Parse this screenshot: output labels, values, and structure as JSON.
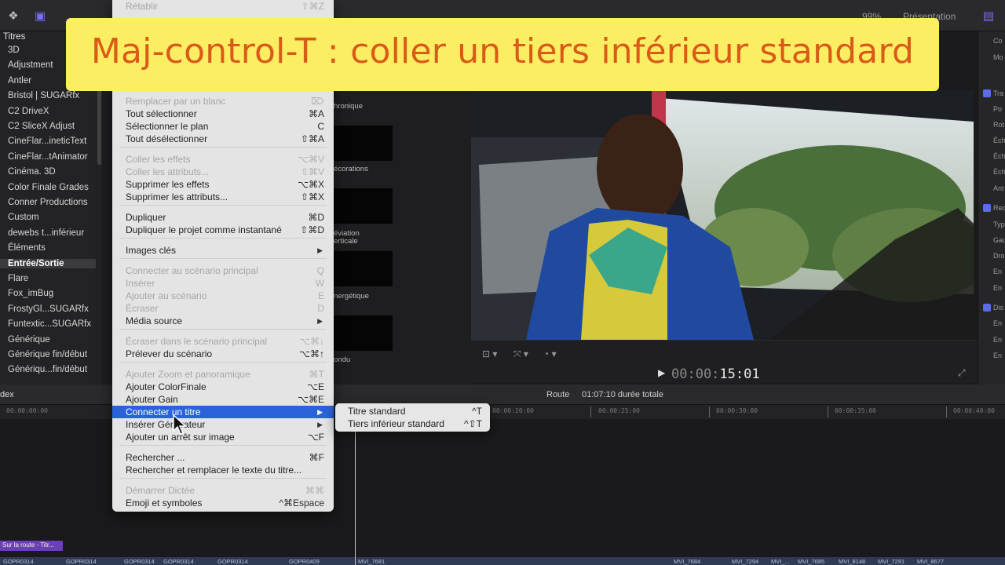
{
  "banner": {
    "text": "Maj-control-T : coller un tiers inférieur standard"
  },
  "topbar": {
    "right_label": "Présentation",
    "right_pct": "99%"
  },
  "sidebar": {
    "header": "Titres",
    "items": [
      "3D",
      "Adjustment",
      "Antler",
      "Bristol | SUGARfx",
      "C2 DriveX",
      "C2 SliceX Adjust",
      "CineFlar...ineticText",
      "CineFlar...tAnimator",
      "Cinéma. 3D",
      "Color Finale Grades",
      "Conner Productions",
      "Custom",
      "dewebs t...inférieur",
      "Éléments",
      "Entrée/Sortie",
      "Flare",
      "Fox_imBug",
      "FrostyGl...SUGARfx",
      "Funtextic...SUGARfx",
      "Générique",
      "Générique fin/début",
      "Génériqu...fin/début"
    ],
    "selected_index": 14
  },
  "browser_labels": [
    "hronique",
    "écorations",
    "éviation",
    "erticale",
    "nergétique",
    "ondu"
  ],
  "menu": {
    "items": [
      {
        "label": "Rétablir",
        "shortcut": "⇧⌘Z",
        "disabled": true
      },
      {
        "label": "Remplacer par un blanc",
        "shortcut": "⌦",
        "disabled": true
      },
      {
        "label": "Tout sélectionner",
        "shortcut": "⌘A"
      },
      {
        "label": "Sélectionner le plan",
        "shortcut": "C"
      },
      {
        "label": "Tout désélectionner",
        "shortcut": "⇧⌘A"
      },
      {
        "label": "Coller les effets",
        "shortcut": "⌥⌘V",
        "disabled": true
      },
      {
        "label": "Coller les attributs...",
        "shortcut": "⇧⌘V",
        "disabled": true
      },
      {
        "label": "Supprimer les effets",
        "shortcut": "⌥⌘X"
      },
      {
        "label": "Supprimer les attributs...",
        "shortcut": "⇧⌘X"
      },
      {
        "label": "Dupliquer",
        "shortcut": "⌘D"
      },
      {
        "label": "Dupliquer le projet comme instantané",
        "shortcut": "⇧⌘D"
      },
      {
        "label": "Images clés",
        "submenu": true
      },
      {
        "label": "Connecter au scénario principal",
        "shortcut": "Q",
        "disabled": true
      },
      {
        "label": "Insérer",
        "shortcut": "W",
        "disabled": true
      },
      {
        "label": "Ajouter au scénario",
        "shortcut": "E",
        "disabled": true
      },
      {
        "label": "Écraser",
        "shortcut": "D",
        "disabled": true
      },
      {
        "label": "Média source",
        "submenu": true
      },
      {
        "label": "Écraser dans le scénario principal",
        "shortcut": "⌥⌘↓",
        "disabled": true
      },
      {
        "label": "Prélever du scénario",
        "shortcut": "⌥⌘↑"
      },
      {
        "label": "Ajouter Zoom et panoramique",
        "shortcut": "⌘T",
        "disabled": true
      },
      {
        "label": "Ajouter ColorFinale",
        "shortcut": "⌥E"
      },
      {
        "label": "Ajouter Gain",
        "shortcut": "⌥⌘E"
      },
      {
        "label": "Connecter un titre",
        "submenu": true,
        "highlighted": true
      },
      {
        "label": "Insérer Générateur",
        "submenu": true
      },
      {
        "label": "Ajouter un arrêt sur image",
        "shortcut": "⌥F"
      },
      {
        "label": "Rechercher ...",
        "shortcut": "⌘F"
      },
      {
        "label": "Rechercher et remplacer le texte du titre..."
      },
      {
        "label": "Démarrer Dictée",
        "shortcut": "⌘⌘",
        "disabled": true
      },
      {
        "label": "Emoji et symboles",
        "shortcut": "^⌘Espace"
      }
    ]
  },
  "submenu": {
    "items": [
      {
        "label": "Titre standard",
        "shortcut": "^T"
      },
      {
        "label": "Tiers inférieur standard",
        "shortcut": "^⇧T"
      }
    ]
  },
  "viewer": {
    "timecode_dim": "00:00:",
    "timecode": "15:01"
  },
  "timeline": {
    "index_label": "dex",
    "project_name": "Route",
    "duration": "01:07:10 durée totale",
    "ticks": [
      "00:00:00:00",
      "00:00:20:00",
      "00:00:25:00",
      "00:00:30:00",
      "00:00:35:00",
      "00:00:40:00"
    ],
    "title_clip": "Sur la route - Titr...",
    "clips": [
      "GOPR0314",
      "GOPR0314",
      "GOPR0314",
      "GOPR0314",
      "GOPR0314",
      "GOPR0409",
      "MVI_7681",
      "MVI_7684",
      "MVI_7294",
      "MVI_...",
      "MVI_7685",
      "MVI_8148",
      "MVI_7291",
      "MVI_8677"
    ]
  },
  "inspector": {
    "labels": [
      "Co",
      "Mo",
      "Tra",
      "Po",
      "Rot",
      "Éch",
      "Éch",
      "Éch",
      "Ant",
      "Rec",
      "Typ",
      "Gau",
      "Dro",
      "En",
      "En",
      "Dis",
      "En",
      "En",
      "En"
    ]
  },
  "colors": {
    "banner_bg": "#fbee63",
    "banner_text": "#d95b17",
    "menu_highlight": "#2a63d9",
    "title_clip": "#6b3fb6"
  }
}
